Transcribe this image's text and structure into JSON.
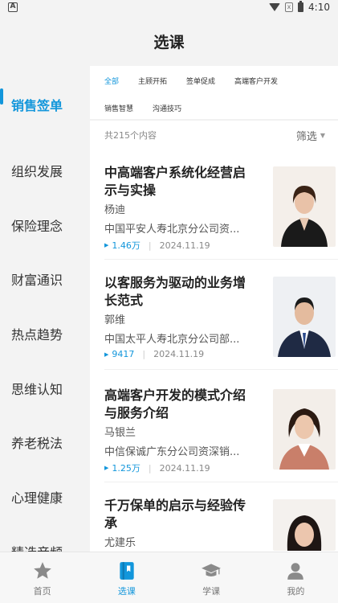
{
  "status": {
    "time": "4:10",
    "left_badge": "A",
    "sim_label": "x"
  },
  "header": {
    "title": "选课"
  },
  "sidebar": {
    "items": [
      {
        "label": "销售签单",
        "active": true
      },
      {
        "label": "组织发展"
      },
      {
        "label": "保险理念"
      },
      {
        "label": "财富通识"
      },
      {
        "label": "热点趋势"
      },
      {
        "label": "思维认知"
      },
      {
        "label": "养老税法"
      },
      {
        "label": "心理健康"
      },
      {
        "label": "精选音频"
      }
    ]
  },
  "tags": {
    "row1": [
      "全部",
      "主顾开拓",
      "签单促成",
      "高端客户开发"
    ],
    "row2": [
      "销售智慧",
      "沟通技巧"
    ],
    "active": "全部"
  },
  "list": {
    "count": "共215个内容",
    "filter": "筛选",
    "courses": [
      {
        "title": "中高端客户系统化经营启示与实操",
        "author": "杨迪",
        "org": "中国平安人寿北京分公司资...",
        "views": "1.46万",
        "date": "2024.11.19"
      },
      {
        "title": "以客服务为驱动的业务增长范式",
        "author": "郭维",
        "org": "中国太平人寿北京分公司部...",
        "views": "9417",
        "date": "2024.11.19"
      },
      {
        "title": "高端客户开发的模式介绍与服务介绍",
        "author": "马银兰",
        "org": "中信保诚广东分公司资深销...",
        "views": "1.25万",
        "date": "2024.11.19"
      },
      {
        "title": "千万保单的启示与经验传承",
        "author": "尤建乐",
        "org": "",
        "views": "",
        "date": ""
      }
    ]
  },
  "tabbar": {
    "items": [
      {
        "label": "首页",
        "icon": "star-icon"
      },
      {
        "label": "选课",
        "icon": "book-icon",
        "active": true
      },
      {
        "label": "学课",
        "icon": "graduation-cap-icon"
      },
      {
        "label": "我的",
        "icon": "person-icon"
      }
    ]
  },
  "colors": {
    "accent": "#1296db",
    "background": "#f3f3f3"
  }
}
